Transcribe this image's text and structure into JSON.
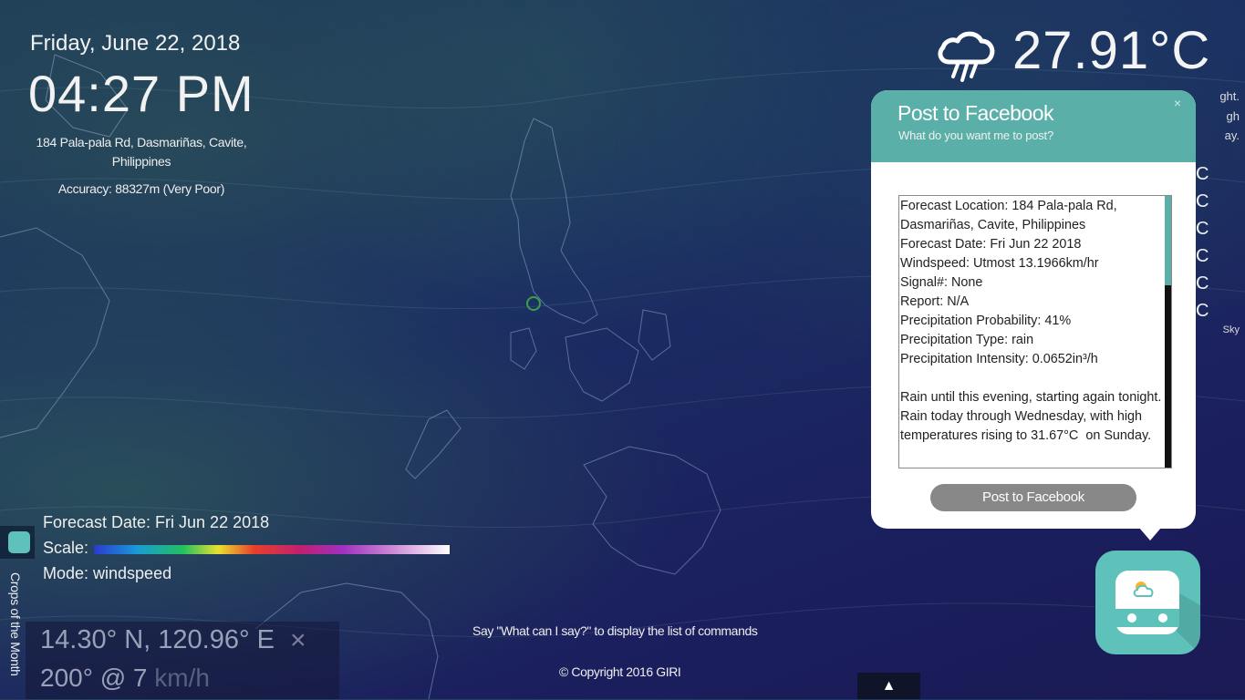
{
  "header": {
    "date": "Friday, June 22, 2018",
    "time": "04:27 PM",
    "address": "184 Pala-pala Rd, Dasmariñas, Cavite, Philippines",
    "accuracy": "Accuracy: 88327m (Very Poor)"
  },
  "weather": {
    "icon": "rain-cloud-icon",
    "temperature": "27.91°C",
    "side_fragments": [
      "ght.",
      "gh",
      "ay."
    ],
    "side_temps": [
      "C",
      "C",
      "C",
      "C",
      "C",
      "C"
    ],
    "side_sky": "Sky"
  },
  "modal": {
    "title": "Post to Facebook",
    "subtitle": "What do you want me to post?",
    "close": "×",
    "post_text": "Forecast Location: 184 Pala-pala Rd, Dasmariñas, Cavite, Philippines\nForecast Date: Fri Jun 22 2018\nWindspeed: Utmost 13.1966km/hr\nSignal#: None\nReport: N/A\nPrecipitation Probability: 41%\nPrecipitation Type: rain\nPrecipitation Intensity: 0.0652in³/h\n\nRain until this evening, starting again tonight.\nRain today through Wednesday, with high temperatures rising to 31.67°C  on Sunday.",
    "button": "Post to Facebook"
  },
  "legend": {
    "forecast_date": "Forecast Date: Fri Jun 22 2018",
    "scale_label": "Scale:",
    "mode": "Mode: windspeed"
  },
  "sidebar": {
    "crops_label": "Crops of the Month"
  },
  "location_readout": {
    "coords": "14.30° N, 120.96° E",
    "close": "×",
    "wind": "200° @ 7",
    "wind_unit": "km/h"
  },
  "footer": {
    "hint": "Say \"What can I say?\" to display the list of commands",
    "copyright": "© Copyright 2016 GIRI",
    "scroll_top": "▲"
  },
  "colors": {
    "accent": "#5ab0a8",
    "bot_bg": "#5ec2bb",
    "button_gray": "#888888"
  }
}
